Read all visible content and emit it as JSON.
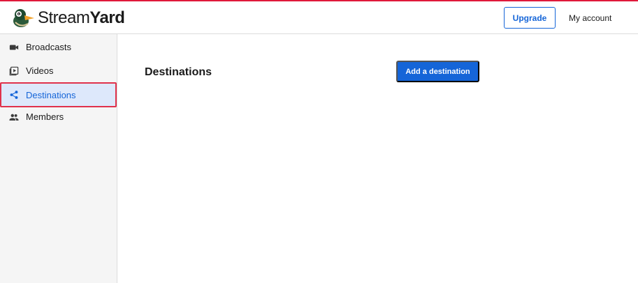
{
  "app": {
    "brand_light": "Stream",
    "brand_bold": "Yard",
    "accent_color": "#1565d8",
    "topline_color": "#e0193a"
  },
  "header": {
    "upgrade_label": "Upgrade",
    "account_label": "My account"
  },
  "sidebar": {
    "items": [
      {
        "label": "Broadcasts",
        "icon": "video-camera-icon",
        "active": false
      },
      {
        "label": "Videos",
        "icon": "video-library-icon",
        "active": false
      },
      {
        "label": "Destinations",
        "icon": "share-icon",
        "active": true
      },
      {
        "label": "Members",
        "icon": "people-icon",
        "active": false
      }
    ]
  },
  "main": {
    "title": "Destinations",
    "add_button_label": "Add a destination"
  }
}
